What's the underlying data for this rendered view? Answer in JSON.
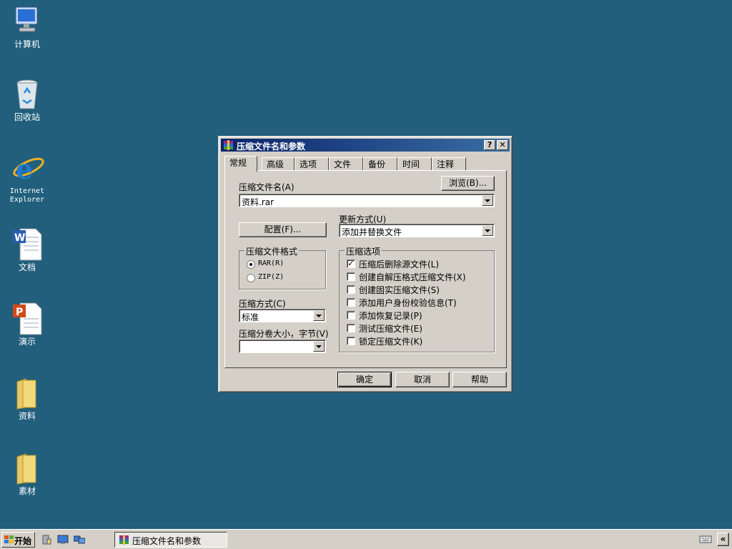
{
  "desktop": {
    "icons": [
      {
        "label": "计算机",
        "icon": "computer-icon"
      },
      {
        "label": "回收站",
        "icon": "recycle-bin-icon"
      },
      {
        "label_line1": "Internet",
        "label_line2": "Explorer",
        "icon": "internet-explorer-icon"
      },
      {
        "label": "文档",
        "icon": "word-document-icon"
      },
      {
        "label": "演示",
        "icon": "powerpoint-document-icon"
      },
      {
        "label": "资料",
        "icon": "folder-icon"
      },
      {
        "label": "素材",
        "icon": "folder-icon"
      }
    ]
  },
  "dialog": {
    "title": "压缩文件名和参数",
    "help_button": "?",
    "close_button": "✕",
    "tabs": [
      "常规",
      "高级",
      "选项",
      "文件",
      "备份",
      "时间",
      "注释"
    ],
    "archive_name_label": "压缩文件名(A)",
    "browse_button": "浏览(B)...",
    "archive_name_value": "资料.rar",
    "update_mode_label": "更新方式(U)",
    "update_mode_value": "添加并替换文件",
    "profiles_button": "配置(F)...",
    "format_group_title": "压缩文件格式",
    "format_options": [
      {
        "label": "RAR(R)",
        "selected": true
      },
      {
        "label": "ZIP(Z)",
        "selected": false
      }
    ],
    "method_label": "压缩方式(C)",
    "method_value": "标准",
    "split_label": "压缩分卷大小，字节(V)",
    "split_value": "",
    "options_group_title": "压缩选项",
    "options": [
      {
        "label": "压缩后删除源文件(L)",
        "checked": true
      },
      {
        "label": "创建自解压格式压缩文件(X)",
        "checked": false
      },
      {
        "label": "创建固实压缩文件(S)",
        "checked": false
      },
      {
        "label": "添加用户身份校验信息(T)",
        "checked": false
      },
      {
        "label": "添加恢复记录(P)",
        "checked": false
      },
      {
        "label": "测试压缩文件(E)",
        "checked": false
      },
      {
        "label": "锁定压缩文件(K)",
        "checked": false
      }
    ],
    "ok_button": "确定",
    "cancel_button": "取消",
    "help_btn": "帮助"
  },
  "taskbar": {
    "start_label": "开始",
    "task_label": "压缩文件名和参数",
    "tray_toggle": "«"
  },
  "colors": {
    "desktop": "#215F7C",
    "title_bar": "#0A246A",
    "face": "#D4D0C8"
  }
}
